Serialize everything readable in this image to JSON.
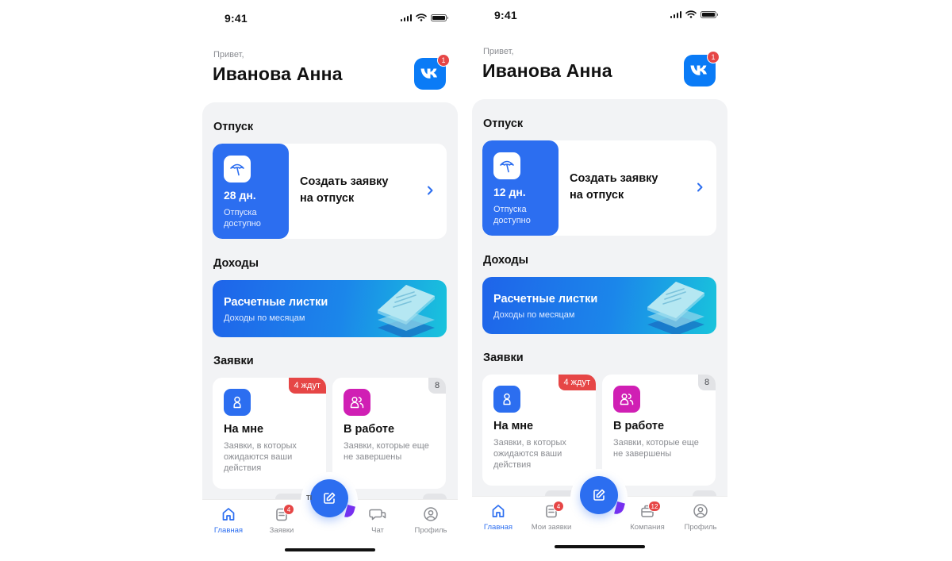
{
  "screens": [
    {
      "status": {
        "time": "9:41"
      },
      "greeting": "Привет,",
      "user_name": "Иванова Анна",
      "notification_count": "1",
      "vacation": {
        "section_title": "Отпуск",
        "days": "28 дн.",
        "days_note_1": "Отпуска",
        "days_note_2": "доступно",
        "action_line_1": "Создать заявку",
        "action_line_2": "на отпуск"
      },
      "income": {
        "section_title": "Доходы",
        "card_title": "Расчетные листки",
        "card_subtitle": "Доходы по месяцам"
      },
      "requests": {
        "section_title": "Заявки",
        "mine": {
          "title": "На мне",
          "badge": "4 ждут",
          "desc_1": "Заявки, в которых",
          "desc_2": "ожидаются ваши",
          "desc_3": "действия"
        },
        "in_progress": {
          "title": "В работе",
          "badge": "8",
          "desc_1": "Заявки, которые еще",
          "desc_2": "не завершены"
        }
      },
      "peek_text": "TI",
      "tabs": [
        {
          "label": "Главная",
          "icon": "home-icon",
          "badge": "",
          "active": true
        },
        {
          "label": "Заявки",
          "icon": "requests-icon",
          "badge": "4",
          "active": false
        },
        {
          "label": "Чат",
          "icon": "chat-icon",
          "badge": "",
          "active": false
        },
        {
          "label": "Профиль",
          "icon": "profile-icon",
          "badge": "",
          "active": false
        }
      ]
    },
    {
      "status": {
        "time": "9:41"
      },
      "greeting": "Привет,",
      "user_name": "Иванова Анна",
      "notification_count": "1",
      "vacation": {
        "section_title": "Отпуск",
        "days": "12 дн.",
        "days_note_1": "Отпуска",
        "days_note_2": "доступно",
        "action_line_1": "Создать заявку",
        "action_line_2": "на отпуск"
      },
      "income": {
        "section_title": "Доходы",
        "card_title": "Расчетные листки",
        "card_subtitle": "Доходы по месяцам"
      },
      "requests": {
        "section_title": "Заявки",
        "mine": {
          "title": "На мне",
          "badge": "4 ждут",
          "desc_1": "Заявки, в которых",
          "desc_2": "ожидаются ваши",
          "desc_3": "действия"
        },
        "in_progress": {
          "title": "В работе",
          "badge": "8",
          "desc_1": "Заявки, которые еще",
          "desc_2": "не завершены"
        }
      },
      "tabs": [
        {
          "label": "Главная",
          "icon": "home-icon",
          "badge": "",
          "active": true
        },
        {
          "label": "Мои заявки",
          "icon": "requests-icon",
          "badge": "4",
          "active": false
        },
        {
          "label": "Компания",
          "icon": "company-icon",
          "badge": "12",
          "active": false
        },
        {
          "label": "Профиль",
          "icon": "profile-icon",
          "badge": "",
          "active": false
        }
      ]
    }
  ],
  "colors": {
    "primary": "#2c6ef0",
    "vk_blue": "#0a7bf6",
    "badge_red": "#e64646",
    "magenta": "#d01fb4",
    "panel_bg": "#f2f3f5",
    "text_secondary": "#8a8c91"
  }
}
